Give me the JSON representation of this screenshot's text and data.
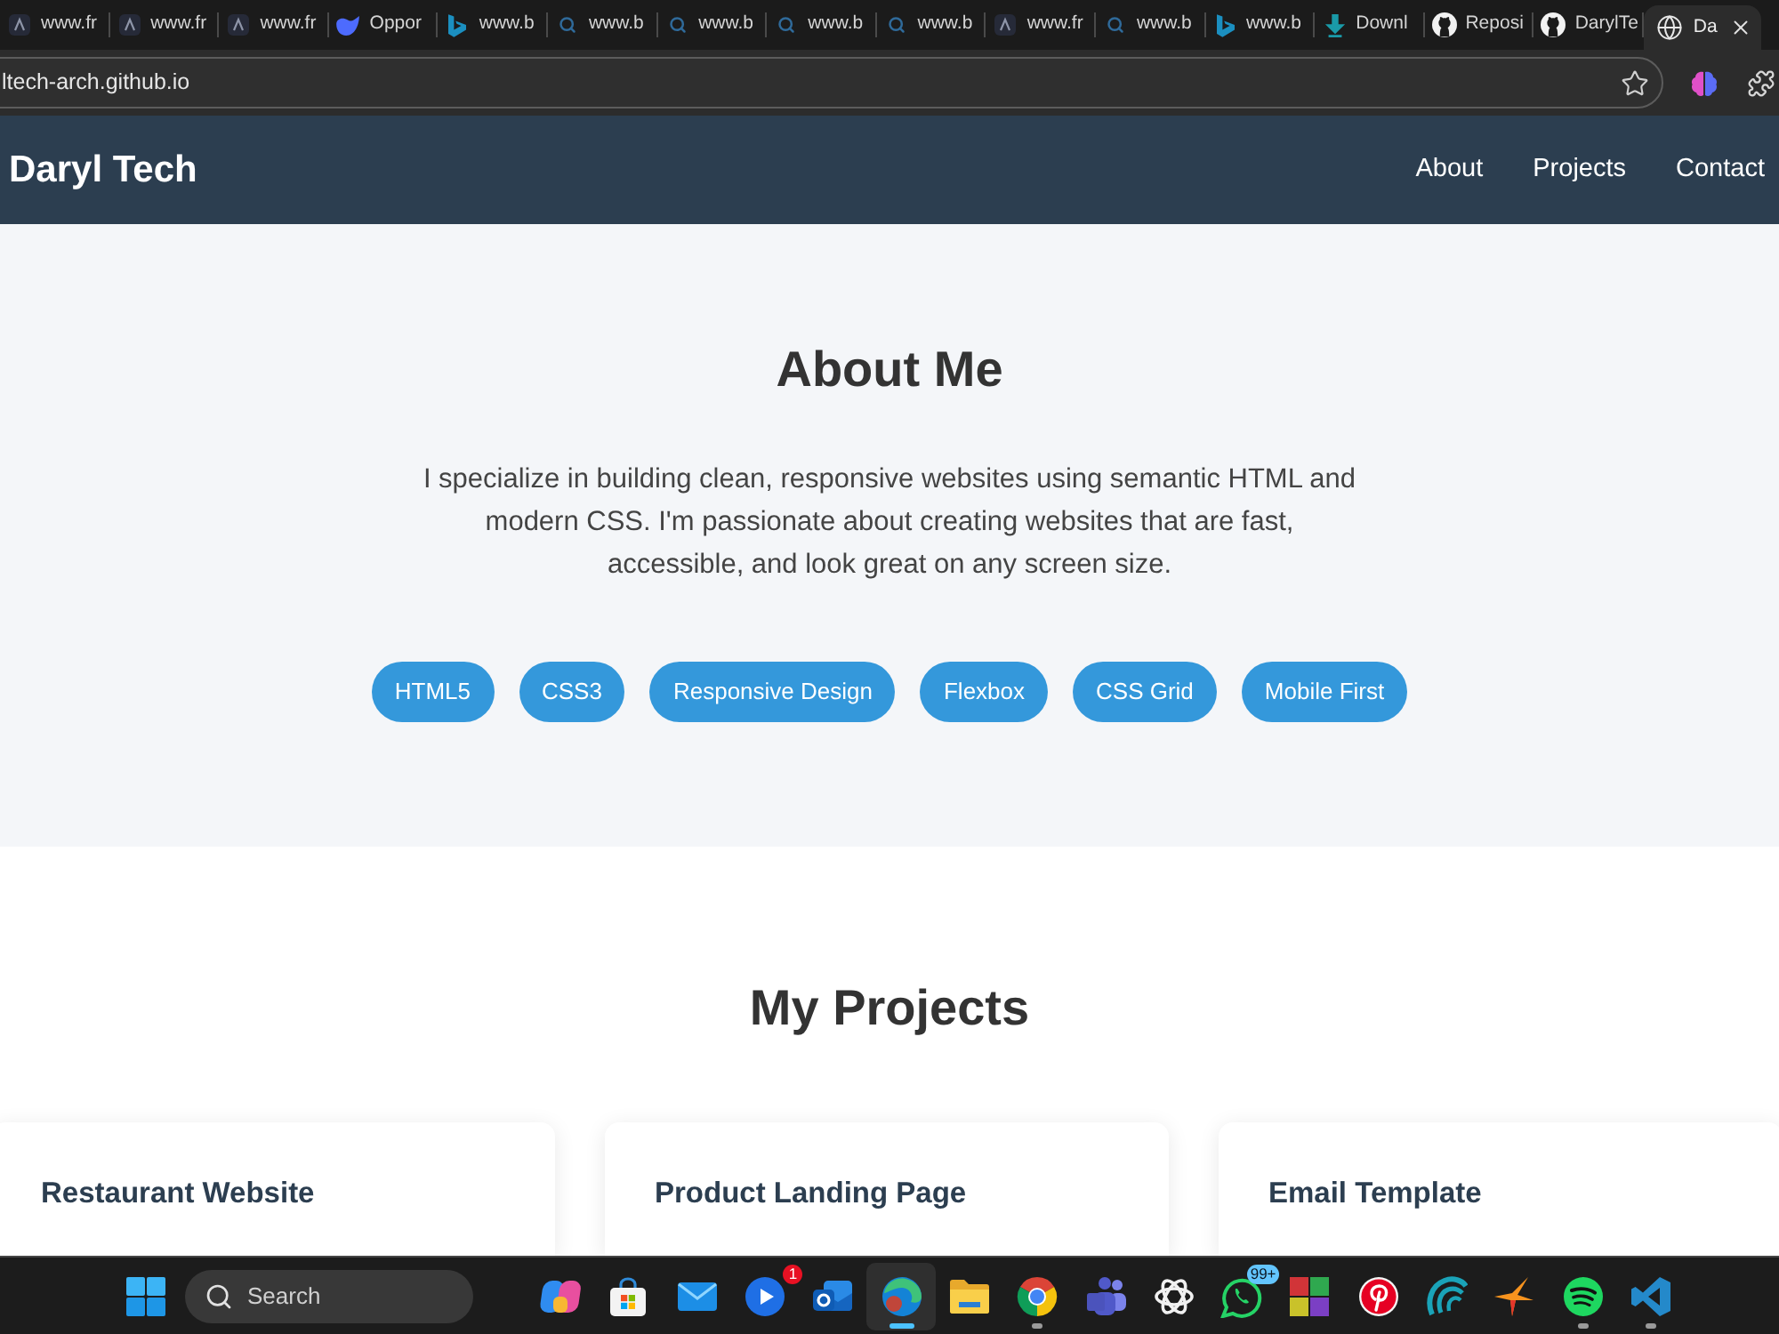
{
  "browser": {
    "tabs": [
      {
        "kind": "triangle",
        "title": "www.fr",
        "selected": false
      },
      {
        "kind": "triangle",
        "title": "www.fr",
        "selected": false
      },
      {
        "kind": "triangle",
        "title": "www.fr",
        "selected": false
      },
      {
        "kind": "swoosh",
        "title": "Oppor",
        "selected": false
      },
      {
        "kind": "ribbon",
        "title": "www.b",
        "selected": false
      },
      {
        "kind": "search",
        "title": "www.b",
        "selected": false
      },
      {
        "kind": "search",
        "title": "www.b",
        "selected": false
      },
      {
        "kind": "search",
        "title": "www.b",
        "selected": false
      },
      {
        "kind": "search",
        "title": "www.b",
        "selected": false
      },
      {
        "kind": "triangle",
        "title": "www.fr",
        "selected": false
      },
      {
        "kind": "search",
        "title": "www.b",
        "selected": false
      },
      {
        "kind": "ribbon",
        "title": "www.b",
        "selected": false
      },
      {
        "kind": "download",
        "title": "Downl",
        "selected": false
      },
      {
        "kind": "cat",
        "title": "Reposi",
        "selected": false
      },
      {
        "kind": "cat",
        "title": "DarylTe",
        "selected": false
      },
      {
        "kind": "globe",
        "title": "Da",
        "selected": true
      }
    ],
    "address_bar": {
      "value": "ltech-arch.github.io"
    }
  },
  "navbar": {
    "brand": "Daryl Tech",
    "links": [
      "About",
      "Projects",
      "Contact"
    ]
  },
  "about": {
    "heading": "About Me",
    "text": "I specialize in building clean, responsive websites using semantic HTML and modern CSS. I'm passionate about creating websites that are fast, accessible, and look great on any screen size.",
    "skills": [
      "HTML5",
      "CSS3",
      "Responsive Design",
      "Flexbox",
      "CSS Grid",
      "Mobile First"
    ]
  },
  "projects": {
    "heading": "My Projects",
    "cards": [
      {
        "title": "Restaurant Website"
      },
      {
        "title": "Product Landing Page"
      },
      {
        "title": "Email Template"
      }
    ]
  },
  "taskbar": {
    "search": {
      "placeholder": "Search"
    },
    "apps": [
      {
        "kind": "swirl",
        "running": false,
        "selected": false
      },
      {
        "kind": "bag",
        "running": false,
        "selected": false
      },
      {
        "kind": "envelope",
        "running": false,
        "selected": false
      },
      {
        "kind": "play",
        "running": false,
        "selected": false,
        "badge": {
          "text": "1",
          "color": "#e81123"
        }
      },
      {
        "kind": "mailbox",
        "running": false,
        "selected": false
      },
      {
        "kind": "orb",
        "running": true,
        "selected": true
      },
      {
        "kind": "folder",
        "running": false,
        "selected": false
      },
      {
        "kind": "segmented",
        "running": true,
        "selected": false
      },
      {
        "kind": "people",
        "running": false,
        "selected": false
      },
      {
        "kind": "knot",
        "running": false,
        "selected": false
      },
      {
        "kind": "chat",
        "running": false,
        "selected": false,
        "badge": {
          "text": "99+",
          "color": "#63c5ff"
        }
      },
      {
        "kind": "tiles",
        "running": false,
        "selected": false
      },
      {
        "kind": "pin",
        "running": false,
        "selected": false
      },
      {
        "kind": "wave",
        "running": false,
        "selected": false
      },
      {
        "kind": "spark",
        "running": false,
        "selected": false
      },
      {
        "kind": "arcs",
        "running": true,
        "selected": false
      },
      {
        "kind": "bracket",
        "running": true,
        "selected": false
      }
    ]
  }
}
